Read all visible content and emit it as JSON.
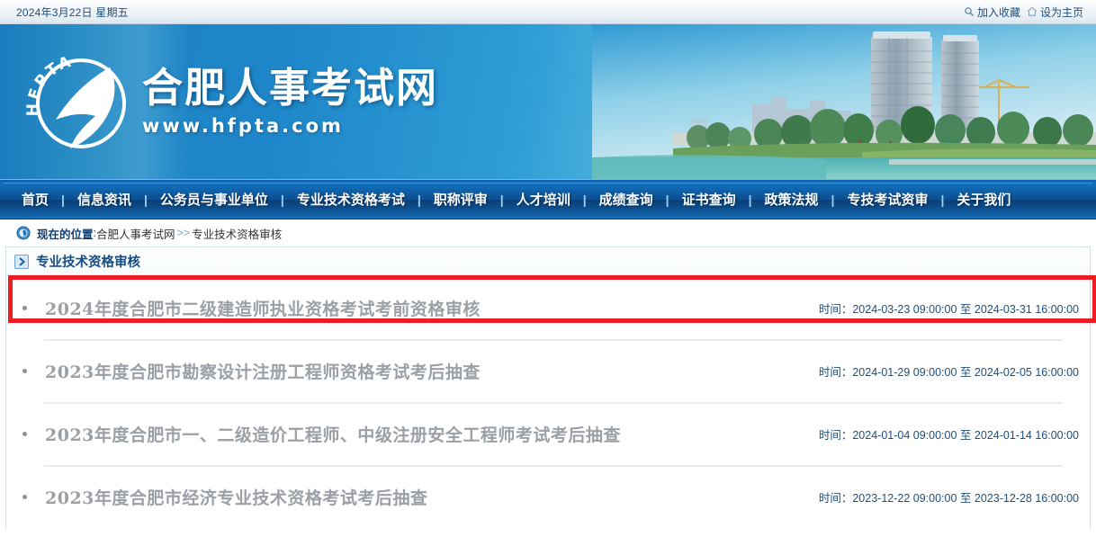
{
  "topbar": {
    "date": "2024年3月22日 星期五",
    "favorite_label": "加入收藏",
    "homepage_label": "设为主页",
    "favorite_icon": "search-star-icon",
    "homepage_icon": "home-icon"
  },
  "banner": {
    "logo_acronym": "HFPTA",
    "site_title": "合肥人事考试网",
    "site_url": "www.hfpta.com",
    "photo_alt": "合肥城市景观照片"
  },
  "nav": {
    "items": [
      {
        "label": "首页"
      },
      {
        "label": "信息资讯"
      },
      {
        "label": "公务员与事业单位"
      },
      {
        "label": "专业技术资格考试"
      },
      {
        "label": "职称评审"
      },
      {
        "label": "人才培训"
      },
      {
        "label": "成绩查询"
      },
      {
        "label": "证书查询"
      },
      {
        "label": "政策法规"
      },
      {
        "label": "专技考试资审"
      },
      {
        "label": "关于我们"
      }
    ],
    "separator": "|"
  },
  "breadcrumb": {
    "icon": "location-clock-icon",
    "label": "现在的位置",
    "colon": ":",
    "root": "合肥人事考试网",
    "arrow": ">>",
    "current": "专业技术资格审核"
  },
  "panel": {
    "arrow_icon": "chevron-right-icon",
    "title": "专业技术资格审核",
    "time_prefix": "时间：",
    "time_joiner": "至",
    "items": [
      {
        "title": "2024年度合肥市二级建造师执业资格考试考前资格审核",
        "time_label": "时间：",
        "time_start": "2024-03-23 09:00:00",
        "time_joiner": "至",
        "time_end": "2024-03-31 16:00:00",
        "highlighted": true
      },
      {
        "title": "2023年度合肥市勘察设计注册工程师资格考试考后抽查",
        "time_label": "时间：",
        "time_start": "2024-01-29 09:00:00",
        "time_joiner": "至",
        "time_end": "2024-02-05 16:00:00",
        "highlighted": false
      },
      {
        "title": "2023年度合肥市一、二级造价工程师、中级注册安全工程师考试考后抽查",
        "time_label": "时间：",
        "time_start": "2024-01-04 09:00:00",
        "time_joiner": "至",
        "time_end": "2024-01-14 16:00:00",
        "highlighted": false
      },
      {
        "title": "2023年度合肥市经济专业技术资格考试考后抽查",
        "time_label": "时间：",
        "time_start": "2023-12-22 09:00:00",
        "time_joiner": "至",
        "time_end": "2023-12-28 16:00:00",
        "highlighted": false
      }
    ]
  },
  "colors": {
    "nav_blue": "#0c4c8f",
    "banner_blue": "#1e87c9",
    "accent_red": "#ee1c25",
    "link_gray": "#9aa0a6",
    "time_blue": "#1f4e79"
  }
}
